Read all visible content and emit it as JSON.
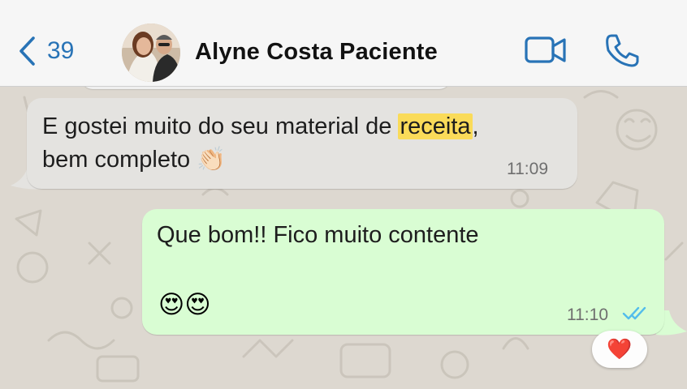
{
  "header": {
    "back_count": "39",
    "contact_name": "Alyne Costa Paciente"
  },
  "messages": [
    {
      "direction": "incoming",
      "text_before": "E gostei muito do seu material de ",
      "highlight": "receita",
      "text_after": ",",
      "line2": "bem completo ",
      "emoji": "👏🏻",
      "time": "11:09"
    },
    {
      "direction": "outgoing",
      "text": "Que bom!! Fico muito contente",
      "emojis": "😍😍",
      "time": "11:10",
      "status": "read",
      "reaction": "❤️"
    }
  ],
  "colors": {
    "accent": "#2873b6",
    "incoming_bubble": "#e4e3e0",
    "outgoing_bubble": "#d9fdd3",
    "highlight": "#fadb59",
    "read_ticks": "#53bdeb"
  },
  "icons": [
    "chevron-left-icon",
    "video-camera-icon",
    "phone-icon",
    "double-check-icon"
  ]
}
